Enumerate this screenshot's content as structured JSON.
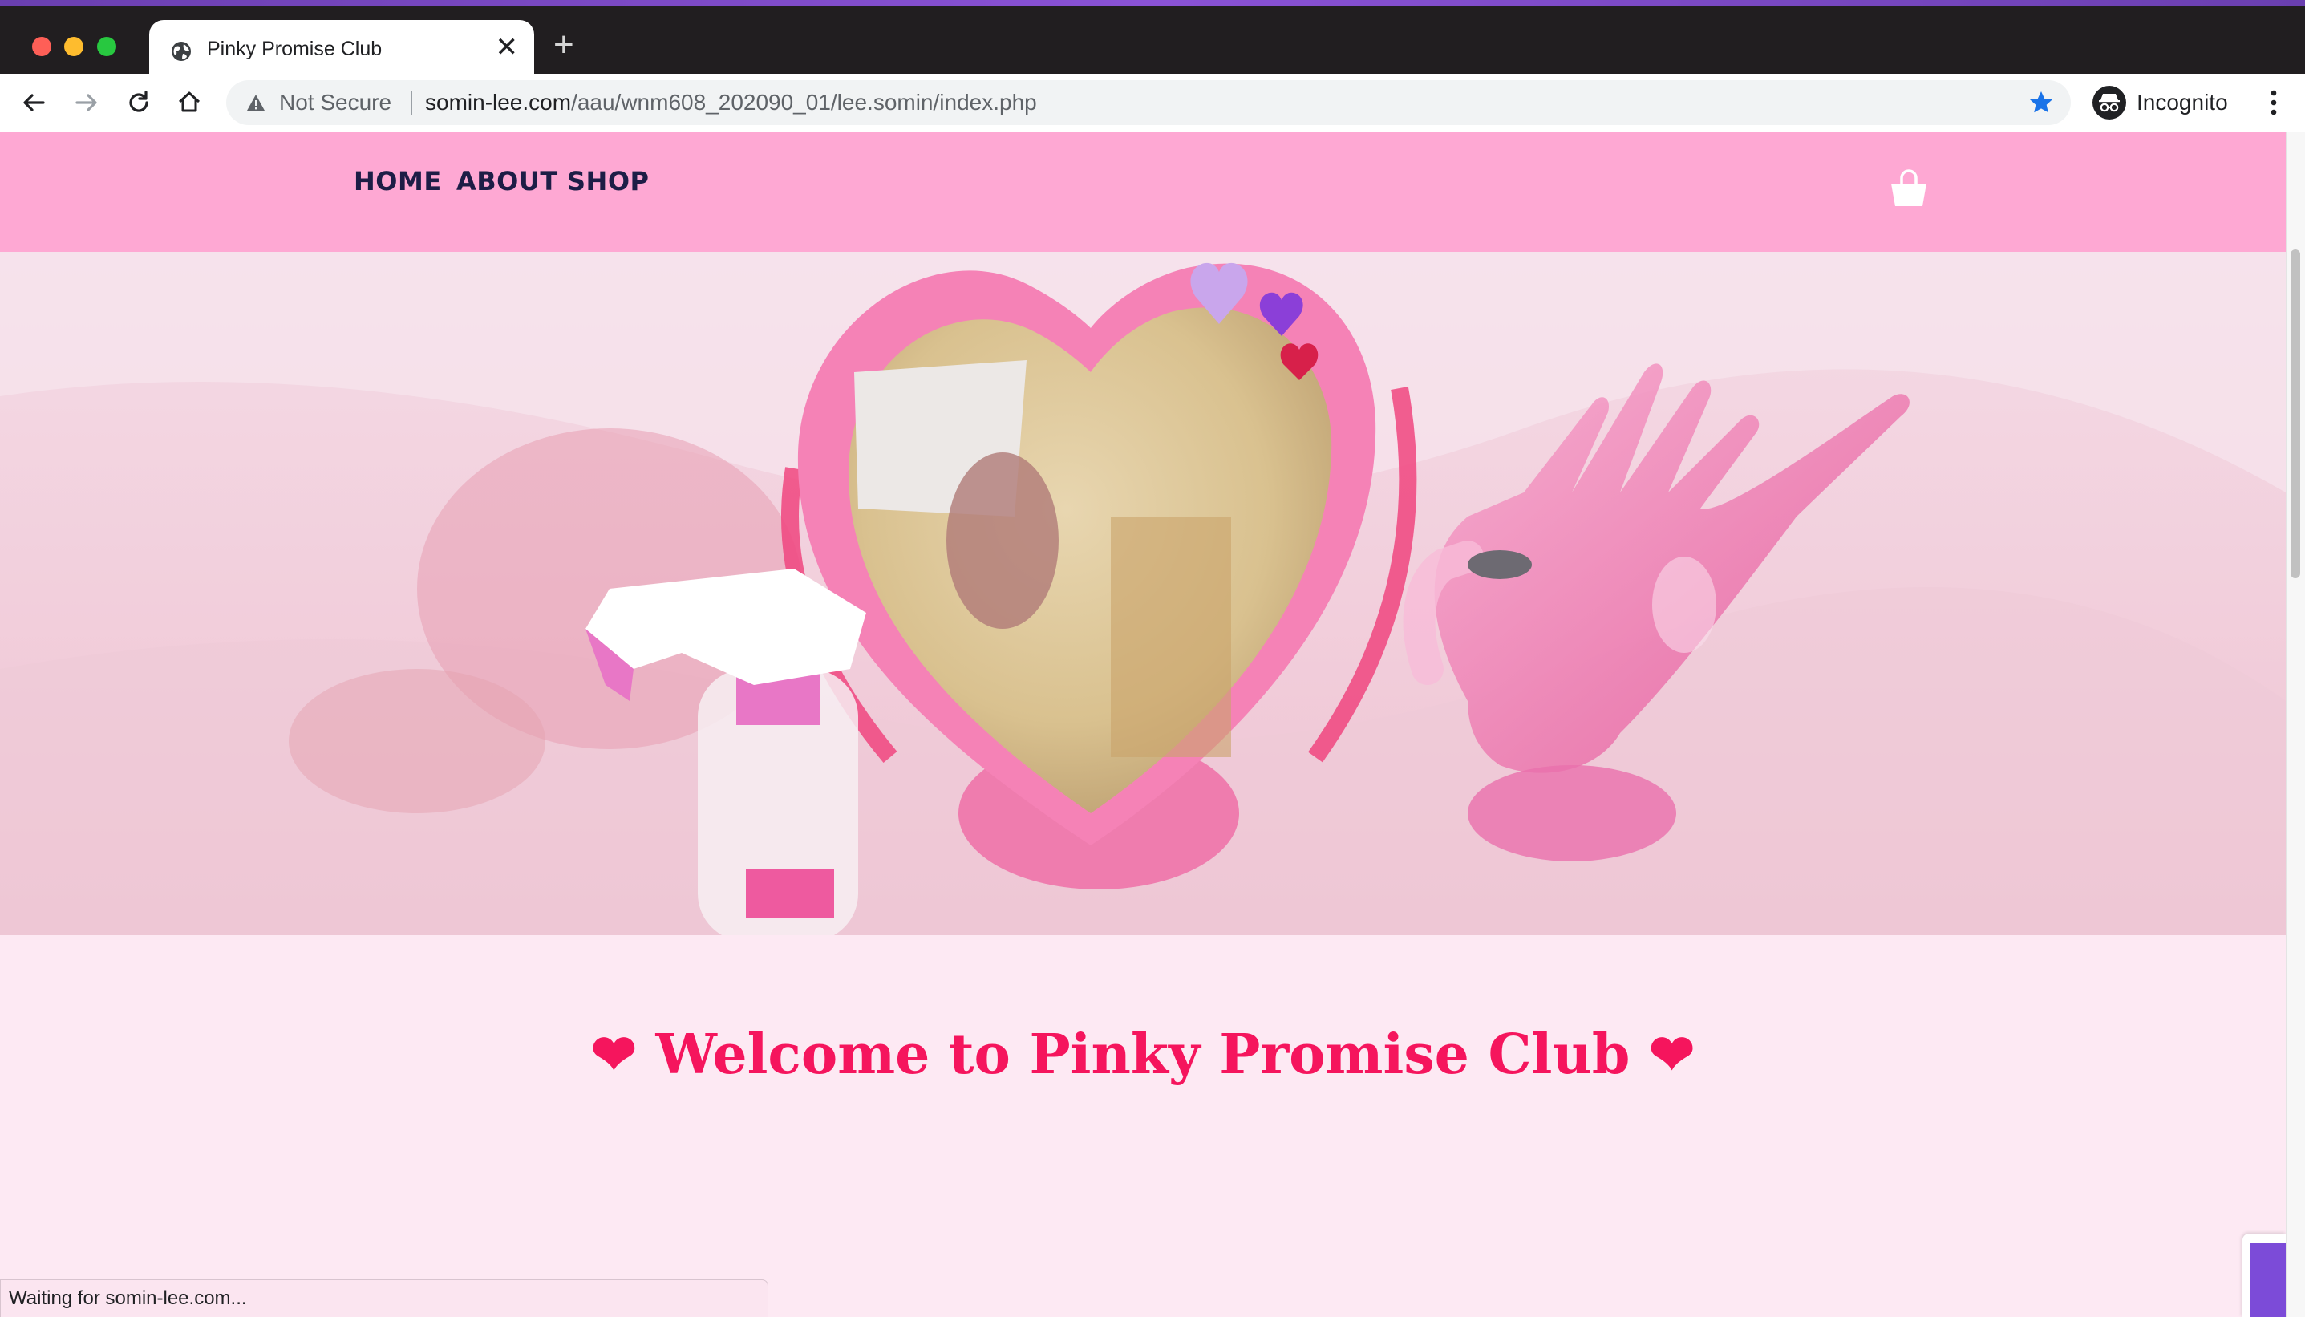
{
  "browser": {
    "tab": {
      "title": "Pinky Promise Club"
    },
    "address": {
      "security_label": "Not Secure",
      "url_host": "somin-lee.com",
      "url_path": "/aau/wnm608_202090_01/lee.somin/index.php"
    },
    "profile": {
      "label": "Incognito"
    },
    "status_text": "Waiting for somin-lee.com..."
  },
  "site": {
    "nav": {
      "home": "HOME",
      "about": "ABOUT",
      "shop": "SHOP"
    },
    "welcome": "❤ Welcome to Pinky Promise Club ❤"
  },
  "colors": {
    "header_pink": "#fea8d3",
    "page_bg": "#fde9f3",
    "nav_text": "#1d1d46",
    "welcome_red": "#f5155d",
    "bookmark_blue": "#1a73e8"
  },
  "icons": [
    "globe-icon",
    "close-icon",
    "plus-icon",
    "back-icon",
    "forward-icon",
    "reload-icon",
    "home-icon",
    "warning-icon",
    "star-icon",
    "incognito-icon",
    "menu-icon",
    "shopping-bag-icon"
  ]
}
